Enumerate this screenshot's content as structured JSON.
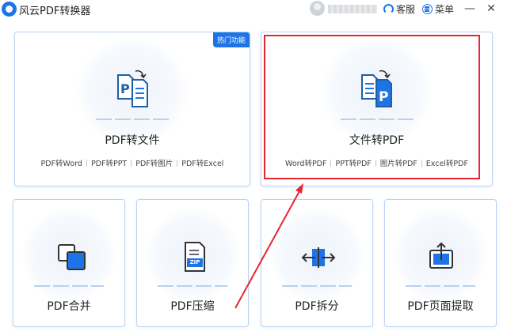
{
  "app": {
    "title": "风云PDF转换器"
  },
  "titlebar": {
    "service_label": "客服",
    "menu_label": "菜单",
    "minimize_glyph": "—",
    "close_glyph": "✕"
  },
  "cards": {
    "pdf_to_file": {
      "title": "PDF转文件",
      "badge": "热门功能",
      "options": [
        "PDF转Word",
        "PDF转PPT",
        "PDF转图片",
        "PDF转Excel"
      ]
    },
    "file_to_pdf": {
      "title": "文件转PDF",
      "options": [
        "Word转PDF",
        "PPT转PDF",
        "图片转PDF",
        "Excel转PDF"
      ]
    },
    "merge": {
      "title": "PDF合并"
    },
    "compress": {
      "title": "PDF压缩",
      "icon_text": "ZIP"
    },
    "split": {
      "title": "PDF拆分"
    },
    "extract": {
      "title": "PDF页面提取"
    }
  },
  "colors": {
    "accent": "#1e74e6",
    "annotation": "#e8262d"
  },
  "icons": {
    "app": "app-logo-icon",
    "service": "headset-icon",
    "menu": "menu-icon",
    "pdf_to_file": "pdf-to-doc-icon",
    "file_to_pdf": "doc-to-pdf-icon",
    "merge": "merge-icon",
    "compress": "zip-icon",
    "split": "split-icon",
    "extract": "extract-page-icon"
  }
}
